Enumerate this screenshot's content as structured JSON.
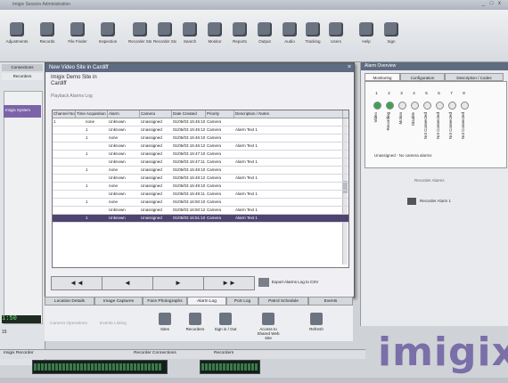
{
  "window": {
    "title": "Imigix Session Administration",
    "controls": "_ □ x"
  },
  "toolbar": {
    "items": [
      {
        "label": "Adjustments",
        "icon": "adjust-icon"
      },
      {
        "label": "Records",
        "icon": "records-icon"
      },
      {
        "label": "File Finder",
        "icon": "file-finder-icon"
      },
      {
        "label": "Inspection",
        "icon": "inspection-icon"
      },
      {
        "label": "Recorder Start",
        "icon": "recorder-icon"
      },
      {
        "label": "Recorder Stop",
        "icon": "stop-icon"
      },
      {
        "label": "Search",
        "icon": "crosshair-icon"
      },
      {
        "label": "Monitor",
        "icon": "monitor-icon"
      },
      {
        "label": "Reports",
        "icon": "reports-icon"
      },
      {
        "label": "Output",
        "icon": "output-icon"
      },
      {
        "label": "Audio",
        "icon": "audio-icon"
      },
      {
        "label": "Tracking",
        "icon": "tracking-icon"
      },
      {
        "label": "Users",
        "icon": "users-icon"
      },
      {
        "label": "Help",
        "icon": "help-icon"
      },
      {
        "label": "Sign",
        "icon": "sign-icon"
      }
    ]
  },
  "left_pane": {
    "tab1": "Connections",
    "tab2": "Recorders",
    "list_item": "Imigix System",
    "counter": "15",
    "clock": "1:50"
  },
  "dialog": {
    "title": "New Video Site in Cardiff",
    "heading_line1": "Imigix Demo Site in",
    "heading_line2": "Cardiff",
    "subheading": "Playback Alarms Log",
    "columns": [
      "Channel No.",
      "Time Acquisition",
      "Alarm",
      "Camera",
      "Date Created",
      "Priority",
      "Description / Notes"
    ],
    "rows": [
      [
        "1",
        "none",
        "Unknown",
        "Unassigned",
        "01/05/03  16:45:10",
        "Camera",
        ""
      ],
      [
        "",
        "1",
        "Unknown",
        "Unassigned",
        "01/05/03  16:45:12",
        "Camera",
        "Alarm Text 1"
      ],
      [
        "",
        "1",
        "none",
        "Unassigned",
        "01/05/03  16:46:10",
        "Camera",
        ""
      ],
      [
        "",
        "",
        "Unknown",
        "Unassigned",
        "01/05/03  16:46:12",
        "Camera",
        "Alarm Text 1"
      ],
      [
        "",
        "1",
        "Unknown",
        "Unassigned",
        "01/05/03  16:47:10",
        "Camera",
        ""
      ],
      [
        "",
        "",
        "Unknown",
        "Unassigned",
        "01/05/03  16:47:11",
        "Camera",
        "Alarm Text 1"
      ],
      [
        "",
        "1",
        "none",
        "Unassigned",
        "01/05/03  16:48:10",
        "Camera",
        ""
      ],
      [
        "",
        "",
        "Unknown",
        "Unassigned",
        "01/05/03  16:48:12",
        "Camera",
        "Alarm Text 1"
      ],
      [
        "",
        "1",
        "none",
        "Unassigned",
        "01/05/03  16:49:10",
        "Camera",
        ""
      ],
      [
        "",
        "",
        "Unknown",
        "Unassigned",
        "01/05/03  16:49:11",
        "Camera",
        "Alarm Text 1"
      ],
      [
        "",
        "1",
        "none",
        "Unassigned",
        "01/05/03  16:50:10",
        "Camera",
        ""
      ],
      [
        "",
        "",
        "Unknown",
        "Unassigned",
        "01/05/03  16:50:12",
        "Camera",
        "Alarm Text 1"
      ]
    ],
    "selected_row": [
      "",
      "1",
      "Unknown",
      "Unassigned",
      "01/05/03  16:51:10",
      "Camera",
      "Alarm Text 1"
    ],
    "nav": [
      "◄◄",
      "◄",
      "►",
      "►►"
    ],
    "export_label": "Export Alarms Log to CSV"
  },
  "tabs": [
    "Location Details",
    "Image Captures",
    "Face Photographs",
    "Alarm Log",
    "PoS Log",
    "Patrol Schedule",
    "Events"
  ],
  "action_bar": {
    "faded1": "Camera Operations",
    "faded2": "Events Listing",
    "items": [
      {
        "label": "Sites",
        "icon": "sites-icon"
      },
      {
        "label": "Recorders",
        "icon": "recorders-icon"
      },
      {
        "label": "Sign in / Out",
        "icon": "sign-in-icon"
      },
      {
        "label": "Access to Shared Web Site",
        "icon": "home-icon"
      },
      {
        "label": "Refresh",
        "icon": "refresh-icon"
      }
    ]
  },
  "right_pane": {
    "title": "Alarm Overview",
    "tabs": [
      "Monitoring",
      "Configuration",
      "Description / Codes"
    ],
    "columns": [
      {
        "num": "1",
        "color": "#3fa24f",
        "label": "Video"
      },
      {
        "num": "2",
        "color": "#3fa24f",
        "label": "Recording"
      },
      {
        "num": "3",
        "color": "#e8e8ea",
        "label": "Motion"
      },
      {
        "num": "4",
        "color": "#e8e8ea",
        "label": "Disable"
      },
      {
        "num": "5",
        "color": "#e8e8ea",
        "label": "Not Connected"
      },
      {
        "num": "6",
        "color": "#e8e8ea",
        "label": "Not Connected"
      },
      {
        "num": "7",
        "color": "#e8e8ea",
        "label": "Not Connected"
      },
      {
        "num": "8",
        "color": "#e8e8ea",
        "label": "Not Connected"
      }
    ],
    "note": "Unassigned - No camera alarms",
    "section": "Recorder Alarms",
    "link": "Recorder Alarm 1"
  },
  "logo": "imigix",
  "status": {
    "left": "Imigix Recorder",
    "mid": "Recorder Connections",
    "right": "Recorders"
  },
  "colors": {
    "accent": "#5e6b80",
    "selection": "#4f4470",
    "logo": "#7a6fa8",
    "led": "#6cf07c"
  }
}
